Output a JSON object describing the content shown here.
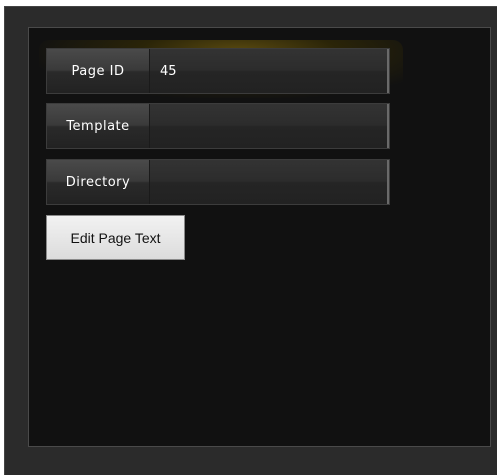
{
  "form": {
    "fields": [
      {
        "label": "Page ID",
        "value": "45"
      },
      {
        "label": "Template",
        "value": ""
      },
      {
        "label": "Directory",
        "value": ""
      }
    ],
    "edit_button_label": "Edit Page Text"
  }
}
